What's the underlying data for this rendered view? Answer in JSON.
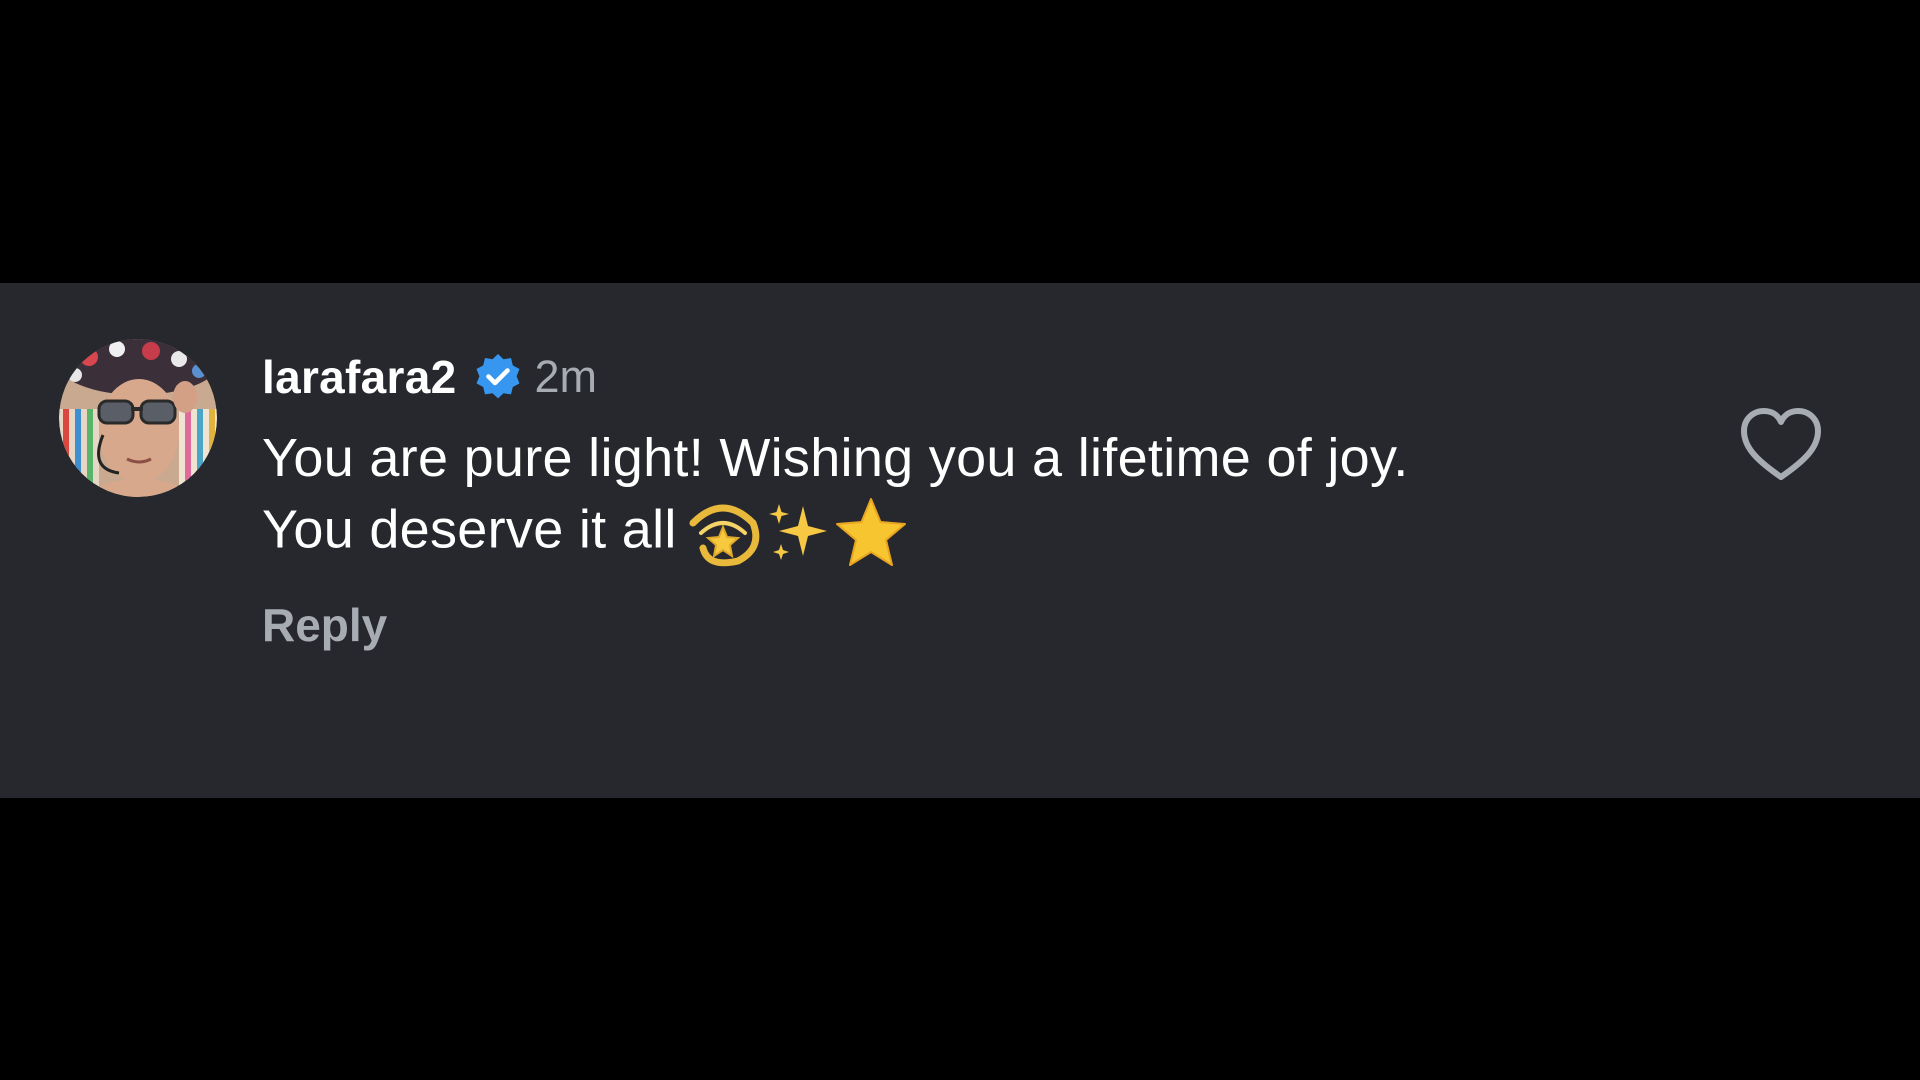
{
  "comment": {
    "username": "larafara2",
    "verified": true,
    "timestamp": "2m",
    "text_line_1": "You are pure light! Wishing you a lifetime of joy.",
    "text_line_2": "You deserve it all",
    "emojis": [
      "dizzy-symbol",
      "sparkles",
      "star"
    ],
    "reply_label": "Reply",
    "liked": false
  },
  "icons": {
    "verified": "verified-badge-icon",
    "like": "heart-outline-icon"
  },
  "colors": {
    "page_background": "#000000",
    "card_background": "#26282d",
    "primary_text": "#ffffff",
    "secondary_text": "#a7abb2",
    "verified_blue": "#3797f0"
  }
}
